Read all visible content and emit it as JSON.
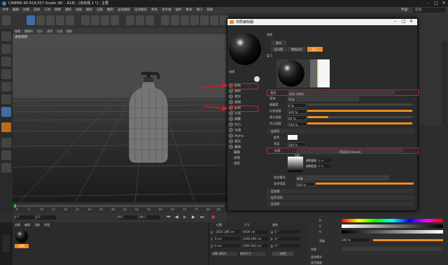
{
  "app": {
    "title": "CINEMA 4D R18.057 Studio (RC - R18) - [未标题 1 *] - 主要"
  },
  "menubar": {
    "items": [
      "文件",
      "编辑",
      "创建",
      "选择",
      "工具",
      "网格",
      "捕捉",
      "动画",
      "模拟",
      "渲染",
      "雕刻",
      "运动跟踪",
      "运动图形",
      "角色",
      "流水线",
      "插件",
      "脚本",
      "窗口",
      "帮助"
    ],
    "layout_label": "界面:",
    "layout_value": "启动"
  },
  "viewport": {
    "menu": [
      "查看",
      "摄像机",
      "显示",
      "选项",
      "过滤",
      "面板"
    ],
    "label": "透视视图"
  },
  "timeline": {
    "ticks": [
      "0",
      "5",
      "10",
      "15",
      "20",
      "25",
      "30",
      "35",
      "40",
      "45",
      "50",
      "55",
      "60",
      "65",
      "70",
      "75",
      "80",
      "85",
      "90"
    ],
    "start": "0 F",
    "current": "0 F",
    "end": "90 F",
    "end2": "90 F"
  },
  "materials_panel": {
    "menu": [
      "创建",
      "编辑",
      "功能",
      "纹理"
    ],
    "material_name": "材质"
  },
  "coords": {
    "headers": [
      "位置",
      "尺寸",
      "旋转"
    ],
    "rows": [
      {
        "axis": "X",
        "pos": "-2024.186 cm",
        "size": "4000 cm",
        "rot_label": "H",
        "rot": "0 °"
      },
      {
        "axis": "Y",
        "pos": "0 cm",
        "size": "1546.294 cm",
        "rot_label": "P",
        "rot": "0 °"
      },
      {
        "axis": "Z",
        "pos": "0 cm",
        "size": "2585.642 cm",
        "rot_label": "B",
        "rot": "0 °"
      }
    ],
    "mode": "对象 (相对)",
    "size_mode": "绝对尺寸",
    "apply": "应用"
  },
  "mat_editor": {
    "title": "材质编辑器",
    "header_label": "材质",
    "name_label": "材质",
    "tabs": [
      "基本",
      "层设置",
      "数据混合",
      "层 1"
    ],
    "layer_label": "层 1",
    "channels": [
      "颜色",
      "漫射",
      "发光",
      "透明",
      "反射",
      "环境",
      "烟雾",
      "凹凸",
      "法线",
      "Alpha",
      "辉光",
      "置换",
      "编辑",
      "光照",
      "指定"
    ],
    "props": [
      {
        "label": "类型",
        "value": "反射 (传统)"
      },
      {
        "label": "衰减",
        "value": "平均"
      },
      {
        "label": "粗糙度",
        "value": "0 %"
      },
      {
        "label": "反射强度",
        "value": "100 %"
      },
      {
        "label": "高光强度",
        "value": "20 %"
      },
      {
        "label": "凹凸强度",
        "value": "100 %"
      }
    ],
    "color_section": "层颜色",
    "color_label": "颜色",
    "brightness_label": "亮度",
    "brightness_value": "100 %",
    "texture_label": "纹理",
    "texture_value": "菲涅耳(Fresnel)",
    "sample_label": "采样",
    "blur_label": "模糊偏移",
    "blur_value": "0 %",
    "blur_scale_label": "模糊程度",
    "blur_scale_value": "0 %",
    "mix_mode_label": "混合模式",
    "mix_mode_value": "普通",
    "mix_strength_label": "混合强度",
    "mix_strength_value": "100 %",
    "sections": [
      "层遮罩",
      "层菲涅耳",
      "层采样"
    ]
  },
  "right_panel": {
    "h_label": "H",
    "s_label": "S",
    "v_label": "V",
    "brightness_label": "亮度",
    "brightness_value": "100 %",
    "texture_label": "纹理",
    "mix_label": "混合模式",
    "mix_strength": "混合强度"
  },
  "colors": {
    "highlight": "#d01e1e",
    "accent": "#f08a24",
    "bg": "#2d2d2d"
  }
}
